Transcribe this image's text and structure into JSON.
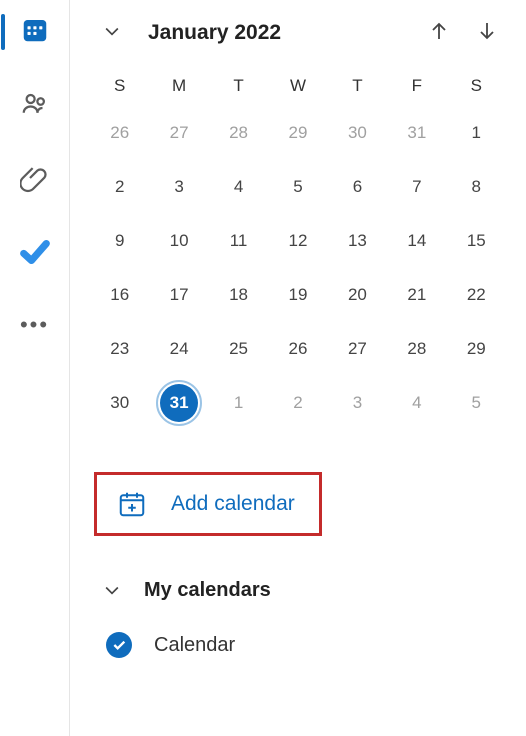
{
  "rail": {
    "apps": [
      {
        "id": "calendar-app",
        "selected": true
      },
      {
        "id": "people-app",
        "selected": false
      },
      {
        "id": "files-app",
        "selected": false
      },
      {
        "id": "todo-app",
        "selected": false
      }
    ],
    "more_label": "•••"
  },
  "month": {
    "label": "January 2022"
  },
  "dow": [
    "S",
    "M",
    "T",
    "W",
    "T",
    "F",
    "S"
  ],
  "weeks": [
    [
      {
        "n": "26",
        "other": true
      },
      {
        "n": "27",
        "other": true
      },
      {
        "n": "28",
        "other": true
      },
      {
        "n": "29",
        "other": true
      },
      {
        "n": "30",
        "other": true
      },
      {
        "n": "31",
        "other": true
      },
      {
        "n": "1"
      }
    ],
    [
      {
        "n": "2"
      },
      {
        "n": "3"
      },
      {
        "n": "4"
      },
      {
        "n": "5"
      },
      {
        "n": "6"
      },
      {
        "n": "7"
      },
      {
        "n": "8"
      }
    ],
    [
      {
        "n": "9"
      },
      {
        "n": "10"
      },
      {
        "n": "11"
      },
      {
        "n": "12"
      },
      {
        "n": "13"
      },
      {
        "n": "14"
      },
      {
        "n": "15"
      }
    ],
    [
      {
        "n": "16"
      },
      {
        "n": "17"
      },
      {
        "n": "18"
      },
      {
        "n": "19"
      },
      {
        "n": "20"
      },
      {
        "n": "21"
      },
      {
        "n": "22"
      }
    ],
    [
      {
        "n": "23"
      },
      {
        "n": "24"
      },
      {
        "n": "25"
      },
      {
        "n": "26"
      },
      {
        "n": "27"
      },
      {
        "n": "28"
      },
      {
        "n": "29"
      }
    ],
    [
      {
        "n": "30"
      },
      {
        "n": "31",
        "today": true
      },
      {
        "n": "1",
        "other": true
      },
      {
        "n": "2",
        "other": true
      },
      {
        "n": "3",
        "other": true
      },
      {
        "n": "4",
        "other": true
      },
      {
        "n": "5",
        "other": true
      }
    ]
  ],
  "add_calendar": {
    "label": "Add calendar"
  },
  "my_calendars": {
    "title": "My calendars",
    "items": [
      {
        "name": "Calendar",
        "checked": true
      }
    ]
  }
}
